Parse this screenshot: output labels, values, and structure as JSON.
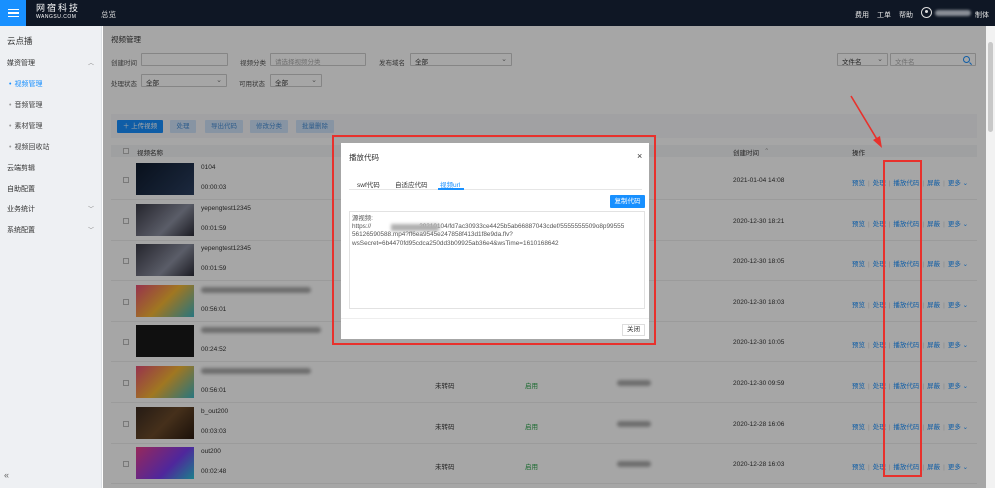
{
  "header": {
    "logo_cn": "网宿科技",
    "logo_en": "WANGSU.COM",
    "overview": "总览",
    "links": [
      "费用",
      "工单",
      "帮助"
    ],
    "user_suffix": "制体"
  },
  "sidebar": {
    "title": "云点播",
    "groups": [
      {
        "label": "媒资管理",
        "items": [
          "视频管理",
          "音频管理",
          "素材管理",
          "视频回收站"
        ]
      },
      {
        "label": "云端剪辑"
      },
      {
        "label": "自助配置"
      },
      {
        "label": "业务统计"
      },
      {
        "label": "系统配置"
      }
    ],
    "collapse_icon": "double-chevron-left-icon"
  },
  "page": {
    "title": "视频管理",
    "filters": {
      "create_time_label": "创建时间",
      "category_label": "视频分类",
      "category_placeholder": "请选择视频分类",
      "domain_label": "发布域名",
      "domain_value": "全部",
      "process_label": "处理状态",
      "process_value": "全部",
      "enable_label": "可用状态",
      "enable_value": "全部",
      "search_type": "文件名",
      "search_placeholder": "文件名"
    },
    "toolbar": [
      "上传视频",
      "处理",
      "导出代码",
      "修改分类",
      "批量删除"
    ],
    "table": {
      "headers": {
        "name": "视频名称",
        "created": "创建时间",
        "ops": "操作"
      },
      "ops": [
        "预览",
        "处理",
        "播放代码",
        "屏蔽",
        "更多"
      ],
      "rows": [
        {
          "name": "0104",
          "duration": "00:00:03",
          "status": "",
          "enable": "",
          "date": "2021-01-04 14:08"
        },
        {
          "name": "yepengtest12345",
          "duration": "00:01:59",
          "status": "",
          "enable": "",
          "date": "2020-12-30 18:21"
        },
        {
          "name": "yepengtest12345",
          "duration": "00:01:59",
          "status": "",
          "enable": "",
          "date": "2020-12-30 18:05"
        },
        {
          "name": "",
          "duration": "00:56:01",
          "status": "",
          "enable": "",
          "date": "2020-12-30 18:03"
        },
        {
          "name": "",
          "duration": "00:24:52",
          "status": "",
          "enable": "",
          "date": "2020-12-30 10:05"
        },
        {
          "name": "",
          "duration": "00:56:01",
          "status": "未转码",
          "enable": "启用",
          "date": "2020-12-30 09:59"
        },
        {
          "name": "b_out200",
          "duration": "00:03:03",
          "status": "未转码",
          "enable": "启用",
          "date": "2020-12-28 16:06"
        },
        {
          "name": "out200",
          "duration": "00:02:48",
          "status": "未转码",
          "enable": "启用",
          "date": "2020-12-28 16:03"
        }
      ]
    }
  },
  "modal": {
    "title": "播放代码",
    "close_glyph": "×",
    "tabs": [
      "swf代码",
      "自适应代码",
      "视频url"
    ],
    "active_tab": "视频url",
    "copy_label": "复制代码",
    "code_label": "源视频:",
    "code_line1": "https://",
    "code_line1b": "20210104/fd7ac30933ce4425b5ab66887043cdef/5555555509o8p99555",
    "code_line2": "56126590588.mp4?ff6ea9545e247858f413d1f8e9da.flv?",
    "code_line3": "wsSecret=6b4470fd95cdca250dd3b09925ab36e4&wsTime=1610168642",
    "close_label": "关闭"
  },
  "colors": {
    "accent": "#1890ff",
    "highlight": "#e8312c",
    "enabled": "#2aa54a"
  }
}
